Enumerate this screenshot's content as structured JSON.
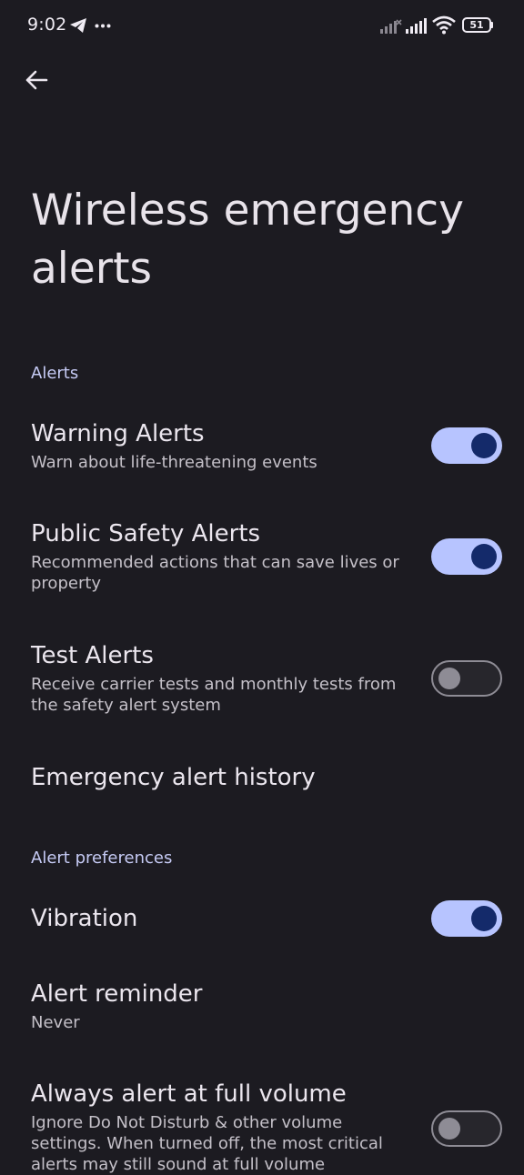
{
  "status_bar": {
    "time": "9:02",
    "battery": "51",
    "icons": [
      "telegram-icon",
      "more-dots-icon",
      "signal-off-icon",
      "signal-icon",
      "wifi-icon",
      "battery-icon"
    ]
  },
  "header": {
    "back_icon": "arrow-back-icon",
    "title": "Wireless emergency alerts"
  },
  "sections": {
    "alerts": {
      "header": "Alerts",
      "warning": {
        "title": "Warning Alerts",
        "summary": "Warn about life-threatening events",
        "enabled": true
      },
      "public_safety": {
        "title": "Public Safety Alerts",
        "summary": "Recommended actions that can save lives or property",
        "enabled": true
      },
      "test": {
        "title": "Test Alerts",
        "summary": "Receive carrier tests and monthly tests from the safety alert system",
        "enabled": false
      },
      "history": {
        "title": "Emergency alert history"
      }
    },
    "preferences": {
      "header": "Alert preferences",
      "vibration": {
        "title": "Vibration",
        "enabled": true
      },
      "reminder": {
        "title": "Alert reminder",
        "summary": "Never"
      },
      "full_volume": {
        "title": "Always alert at full volume",
        "summary": "Ignore Do Not Disturb & other volume settings. When turned off, the most critical alerts may still sound at full volume",
        "enabled": false
      }
    }
  },
  "colors": {
    "background": "#1c1b21",
    "accent": "#b7c4ff",
    "accent_dark": "#142a6a",
    "section_header": "#c6cbf5"
  }
}
